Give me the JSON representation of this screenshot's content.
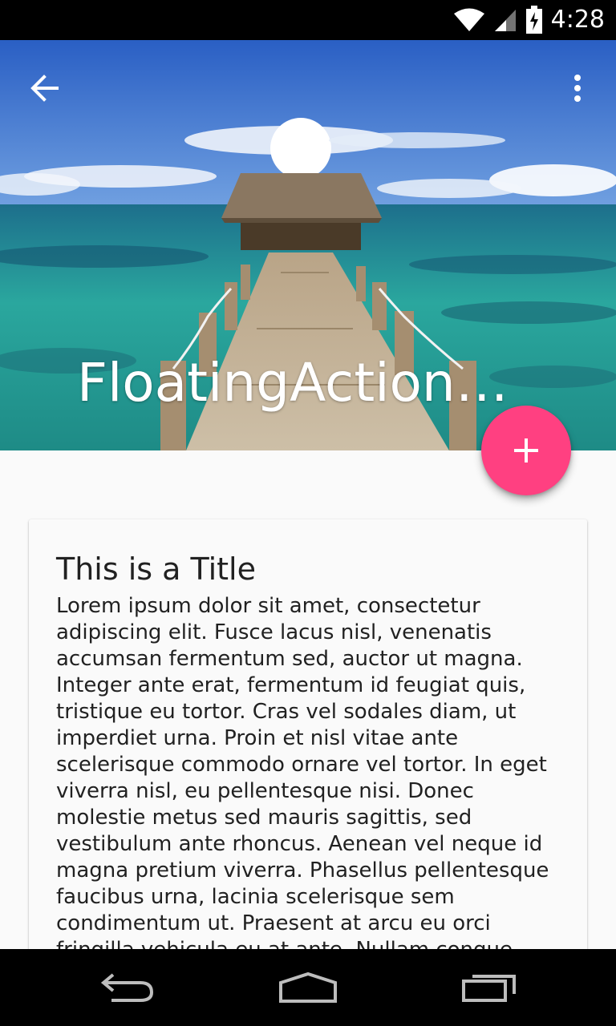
{
  "status_bar": {
    "time": "4:28",
    "icons": [
      "wifi-icon",
      "cell-signal-icon",
      "battery-charging-icon"
    ]
  },
  "toolbar": {
    "title": "FloatingActionButtonBasic",
    "back_icon": "arrow-back-icon",
    "overflow_icon": "more-vert-icon"
  },
  "fab": {
    "icon": "plus-icon",
    "color": "#ff4081"
  },
  "card": {
    "title": "This is a Title",
    "body": "Lorem ipsum dolor sit amet, consectetur adipiscing elit. Fusce lacus nisl, venenatis accumsan fermentum sed, auctor ut magna. Integer ante erat, fermentum id feugiat quis, tristique eu tortor. Cras vel sodales diam, ut imperdiet urna. Proin et nisl vitae ante scelerisque commodo ornare vel tortor. In eget viverra nisl, eu pellentesque nisi. Donec molestie metus sed mauris sagittis, sed vestibulum ante rhoncus. Aenean vel neque id magna pretium viverra. Phasellus pellentesque faucibus urna, lacinia scelerisque sem condimentum ut. Praesent at arcu eu orci fringilla vehicula eu at ante. Nullam congue felis massa, at vehicula"
  },
  "nav_bar": {
    "buttons": [
      "nav-back-icon",
      "nav-home-icon",
      "nav-recents-icon"
    ]
  }
}
